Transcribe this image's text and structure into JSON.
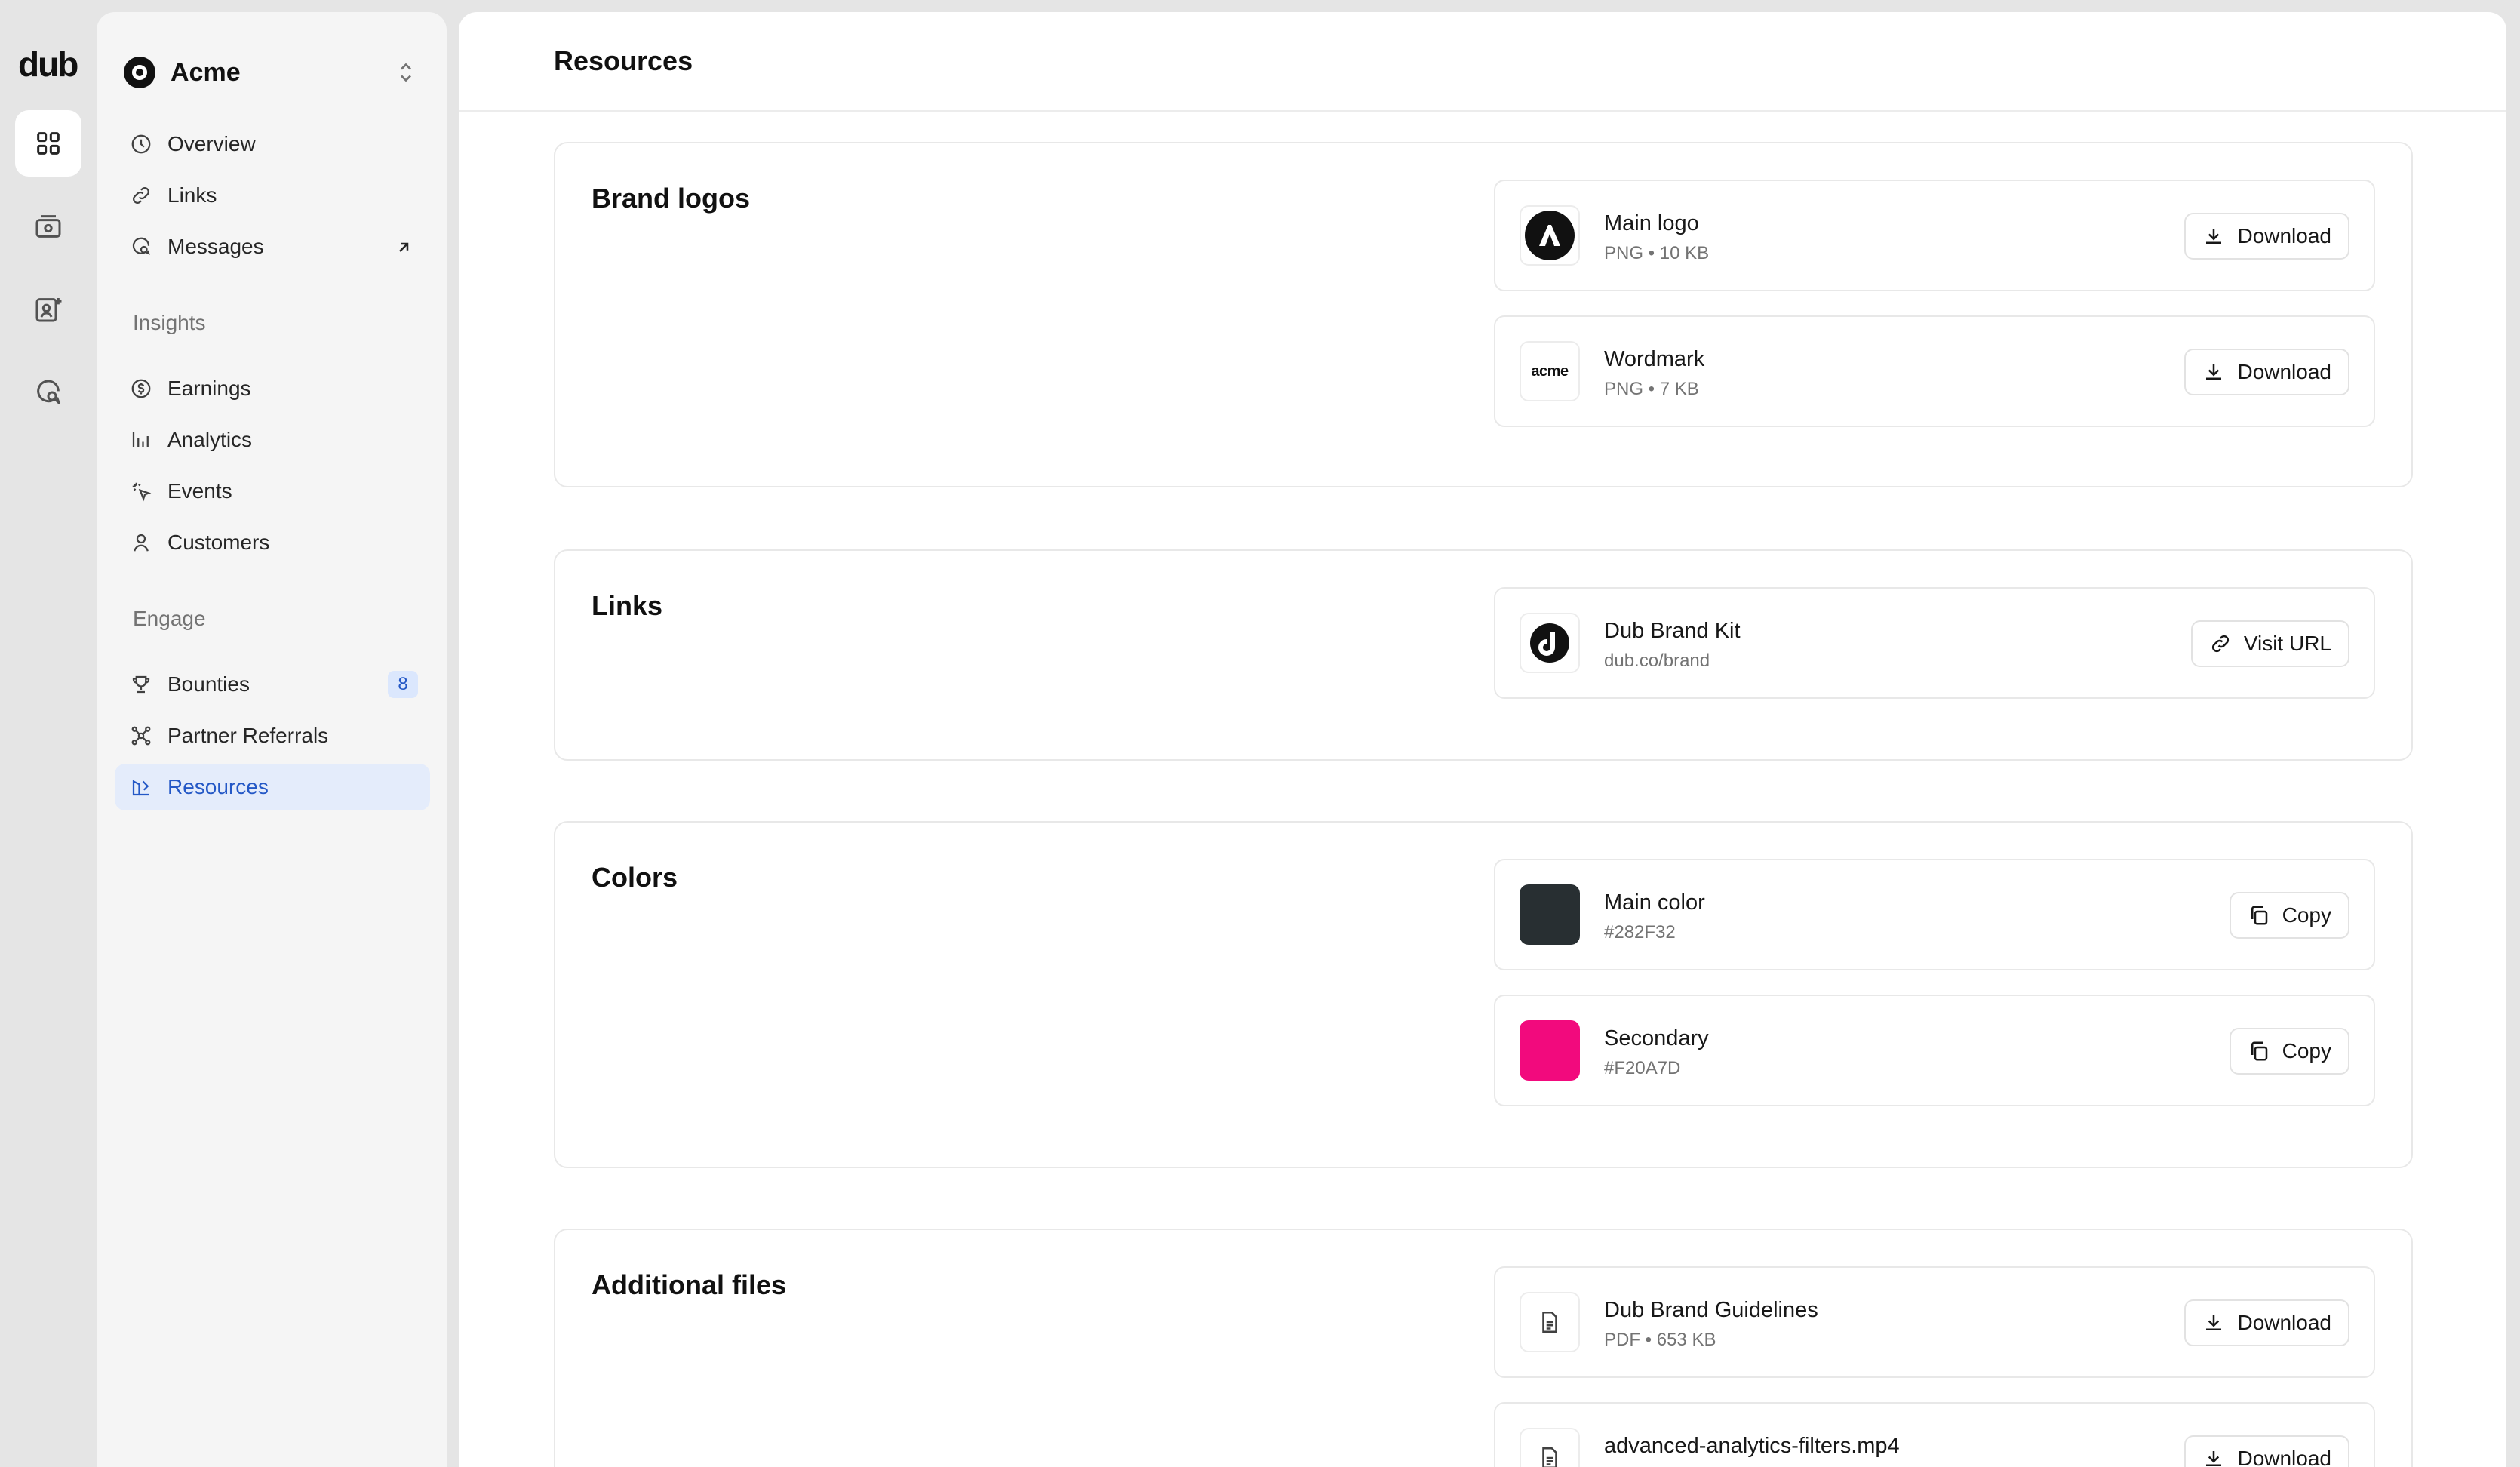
{
  "rail": {
    "logo_text": "dub"
  },
  "workspace": {
    "name": "Acme"
  },
  "nav": {
    "main": [
      {
        "label": "Overview"
      },
      {
        "label": "Links"
      },
      {
        "label": "Messages"
      }
    ],
    "insights_label": "Insights",
    "insights": [
      {
        "label": "Earnings"
      },
      {
        "label": "Analytics"
      },
      {
        "label": "Events"
      },
      {
        "label": "Customers"
      }
    ],
    "engage_label": "Engage",
    "engage": [
      {
        "label": "Bounties",
        "badge": "8"
      },
      {
        "label": "Partner Referrals"
      },
      {
        "label": "Resources"
      }
    ]
  },
  "page": {
    "title": "Resources"
  },
  "sections": {
    "brand_logos": {
      "title": "Brand logos",
      "items": [
        {
          "name": "Main logo",
          "meta": "PNG • 10 KB",
          "action": "Download"
        },
        {
          "name": "Wordmark",
          "meta": "PNG • 7 KB",
          "action": "Download",
          "thumb_text": "acme"
        }
      ]
    },
    "links": {
      "title": "Links",
      "items": [
        {
          "name": "Dub Brand Kit",
          "meta": "dub.co/brand",
          "action": "Visit URL"
        }
      ]
    },
    "colors": {
      "title": "Colors",
      "items": [
        {
          "name": "Main color",
          "meta": "#282F32",
          "action": "Copy",
          "swatch": "#282F32"
        },
        {
          "name": "Secondary",
          "meta": "#F20A7D",
          "action": "Copy",
          "swatch": "#F20A7D"
        }
      ]
    },
    "files": {
      "title": "Additional files",
      "items": [
        {
          "name": "Dub Brand Guidelines",
          "meta": "PDF • 653 KB",
          "action": "Download"
        },
        {
          "name": "advanced-analytics-filters.mp4",
          "meta": "",
          "action": "Download"
        }
      ]
    }
  },
  "theme": {
    "accent": "#2458c6",
    "active_bg": "#e4ecfb"
  }
}
